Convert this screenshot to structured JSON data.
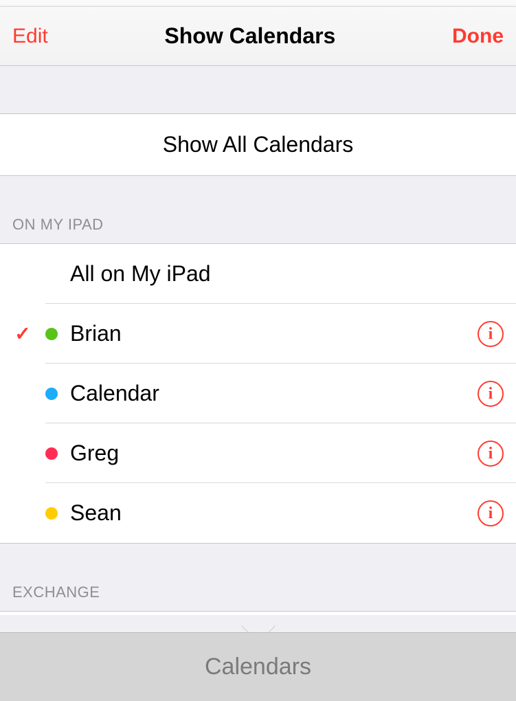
{
  "header": {
    "edit": "Edit",
    "title": "Show Calendars",
    "done": "Done"
  },
  "show_all": "Show All Calendars",
  "sections": {
    "on_my_ipad": {
      "title": "On My iPad",
      "all_label": "All on My iPad",
      "items": [
        {
          "label": "Brian",
          "color": "#5ac31a",
          "checked": true
        },
        {
          "label": "Calendar",
          "color": "#1badf8",
          "checked": false
        },
        {
          "label": "Greg",
          "color": "#ff2d55",
          "checked": false
        },
        {
          "label": "Sean",
          "color": "#ffcc00",
          "checked": false
        }
      ]
    },
    "exchange": {
      "title": "Exchange"
    }
  },
  "bottom": {
    "label": "Calendars"
  },
  "colors": {
    "accent": "#ff3b30"
  }
}
